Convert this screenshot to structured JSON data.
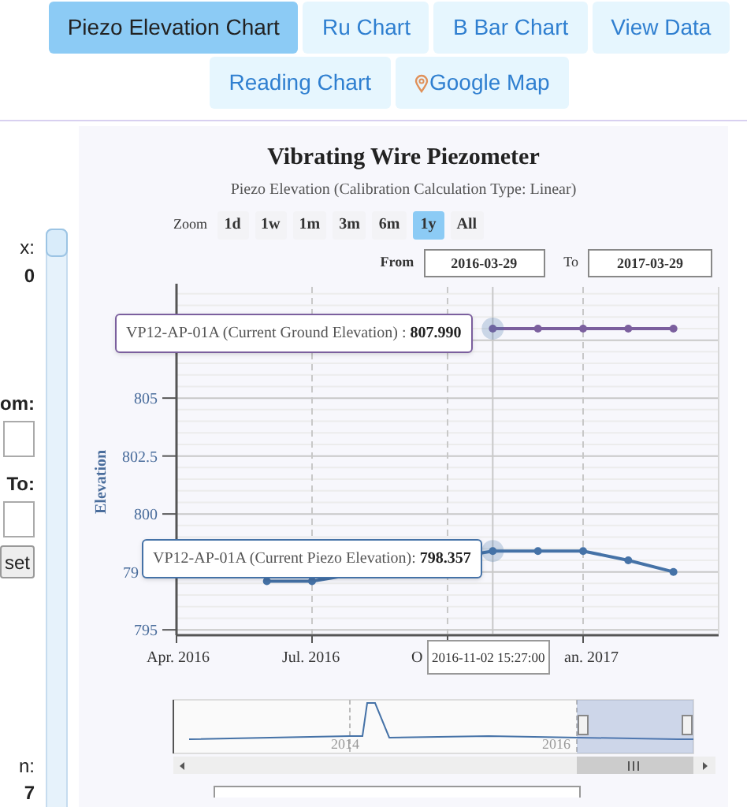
{
  "nav": {
    "tabs": [
      {
        "label": "Piezo Elevation Chart",
        "selected": true
      },
      {
        "label": "Ru Chart",
        "selected": false
      },
      {
        "label": "B Bar Chart",
        "selected": false
      },
      {
        "label": "View Data",
        "selected": false
      },
      {
        "label": "Reading Chart",
        "selected": false
      },
      {
        "label": "Google Map",
        "selected": false
      }
    ]
  },
  "side_panel": {
    "items": [
      {
        "kind": "text",
        "text": "x:"
      },
      {
        "kind": "text",
        "text": "0",
        "bold": true
      },
      {
        "kind": "text",
        "text": "om:",
        "bold": true
      },
      {
        "kind": "input"
      },
      {
        "kind": "text",
        "text": "To:",
        "bold": true
      },
      {
        "kind": "input"
      },
      {
        "kind": "button",
        "text": "set"
      },
      {
        "kind": "text",
        "text": "n:"
      },
      {
        "kind": "text",
        "text": "7",
        "bold": true
      }
    ]
  },
  "chart": {
    "title": "Vibrating Wire Piezometer",
    "subtitle": "Piezo Elevation (Calibration Calculation Type: Linear)",
    "zoom": {
      "label": "Zoom",
      "buttons": [
        {
          "label": "1d",
          "selected": false
        },
        {
          "label": "1w",
          "selected": false
        },
        {
          "label": "1m",
          "selected": false
        },
        {
          "label": "3m",
          "selected": false
        },
        {
          "label": "6m",
          "selected": false
        },
        {
          "label": "1y",
          "selected": true
        },
        {
          "label": "All",
          "selected": false
        }
      ]
    },
    "range": {
      "from_label": "From",
      "from": "2016-03-29",
      "to_label": "To",
      "to": "2017-03-29"
    },
    "tooltips": [
      {
        "label": "VP12-AP-01A (Current Ground Elevation) : ",
        "value": "807.990"
      },
      {
        "label": "VP12-AP-01A (Current Piezo Elevation): ",
        "value": "798.357"
      }
    ],
    "date_tooltip": "2016-11-02 15:27:00",
    "covered_x_labels": [
      "O",
      "an. 2017"
    ],
    "covered_y_label": "79",
    "chart_data": {
      "type": "line",
      "ylabel": "Elevation",
      "categories": [
        "Apr. 2016",
        null,
        null,
        "Jul. 2016",
        null,
        null,
        null,
        null,
        null,
        null,
        null,
        null
      ],
      "ylim": [
        794.7,
        809.8
      ],
      "grid": true,
      "yticks": [
        795,
        800,
        802.5,
        805
      ],
      "series": [
        {
          "color": "#7b5f9e",
          "marker": true,
          "values": [
            null,
            null,
            null,
            null,
            null,
            null,
            null,
            808,
            808,
            808,
            808,
            808
          ]
        },
        {
          "color": "#4572a7",
          "marker": true,
          "values": [
            null,
            null,
            797.1,
            797.1,
            null,
            null,
            null,
            798.4,
            798.4,
            798.4,
            798,
            797.5
          ]
        }
      ]
    },
    "navigator": {
      "labels": [
        "2014",
        "2016"
      ]
    }
  }
}
